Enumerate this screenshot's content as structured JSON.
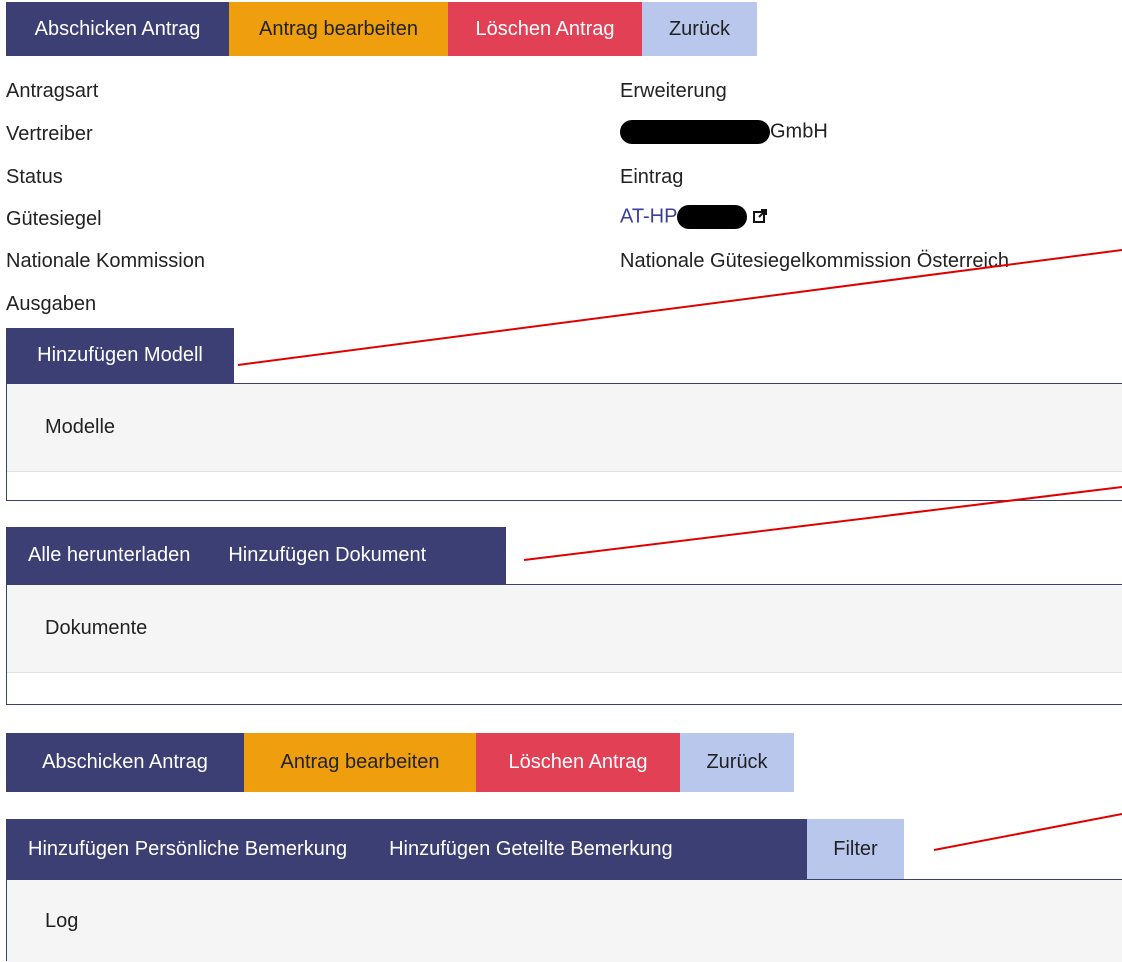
{
  "top_actions": {
    "submit": "Abschicken Antrag",
    "edit": "Antrag bearbeiten",
    "delete": "Löschen Antrag",
    "back": "Zurück"
  },
  "details": {
    "antragsart": {
      "label": "Antragsart",
      "value": "Erweiterung"
    },
    "vertreiber": {
      "label": "Vertreiber",
      "value": "GmbH"
    },
    "status": {
      "label": "Status",
      "value": "Eintrag"
    },
    "guetesiegel": {
      "label": "Gütesiegel",
      "value": "AT-HP"
    },
    "kommission": {
      "label": "Nationale Kommission",
      "value": "Nationale Gütesiegelkommission Österreich"
    },
    "ausgaben": {
      "label": "Ausgaben"
    }
  },
  "models_section": {
    "add_button": "Hinzufügen Modell",
    "header": "Modelle"
  },
  "documents_section": {
    "download_all": "Alle herunterladen",
    "add_button": "Hinzufügen Dokument",
    "header": "Dokumente"
  },
  "bottom_actions": {
    "submit": "Abschicken Antrag",
    "edit": "Antrag bearbeiten",
    "delete": "Löschen Antrag",
    "back": "Zurück"
  },
  "log_section": {
    "add_personal": "Hinzufügen Persönliche Bemerkung",
    "add_shared": "Hinzufügen Geteilte Bemerkung",
    "filter": "Filter",
    "header": "Log"
  },
  "colors": {
    "primary": "#3b3f73",
    "warning": "#ef9f0d",
    "danger": "#e24055",
    "secondary": "#b9c7ec",
    "annotation": "#e00000"
  }
}
